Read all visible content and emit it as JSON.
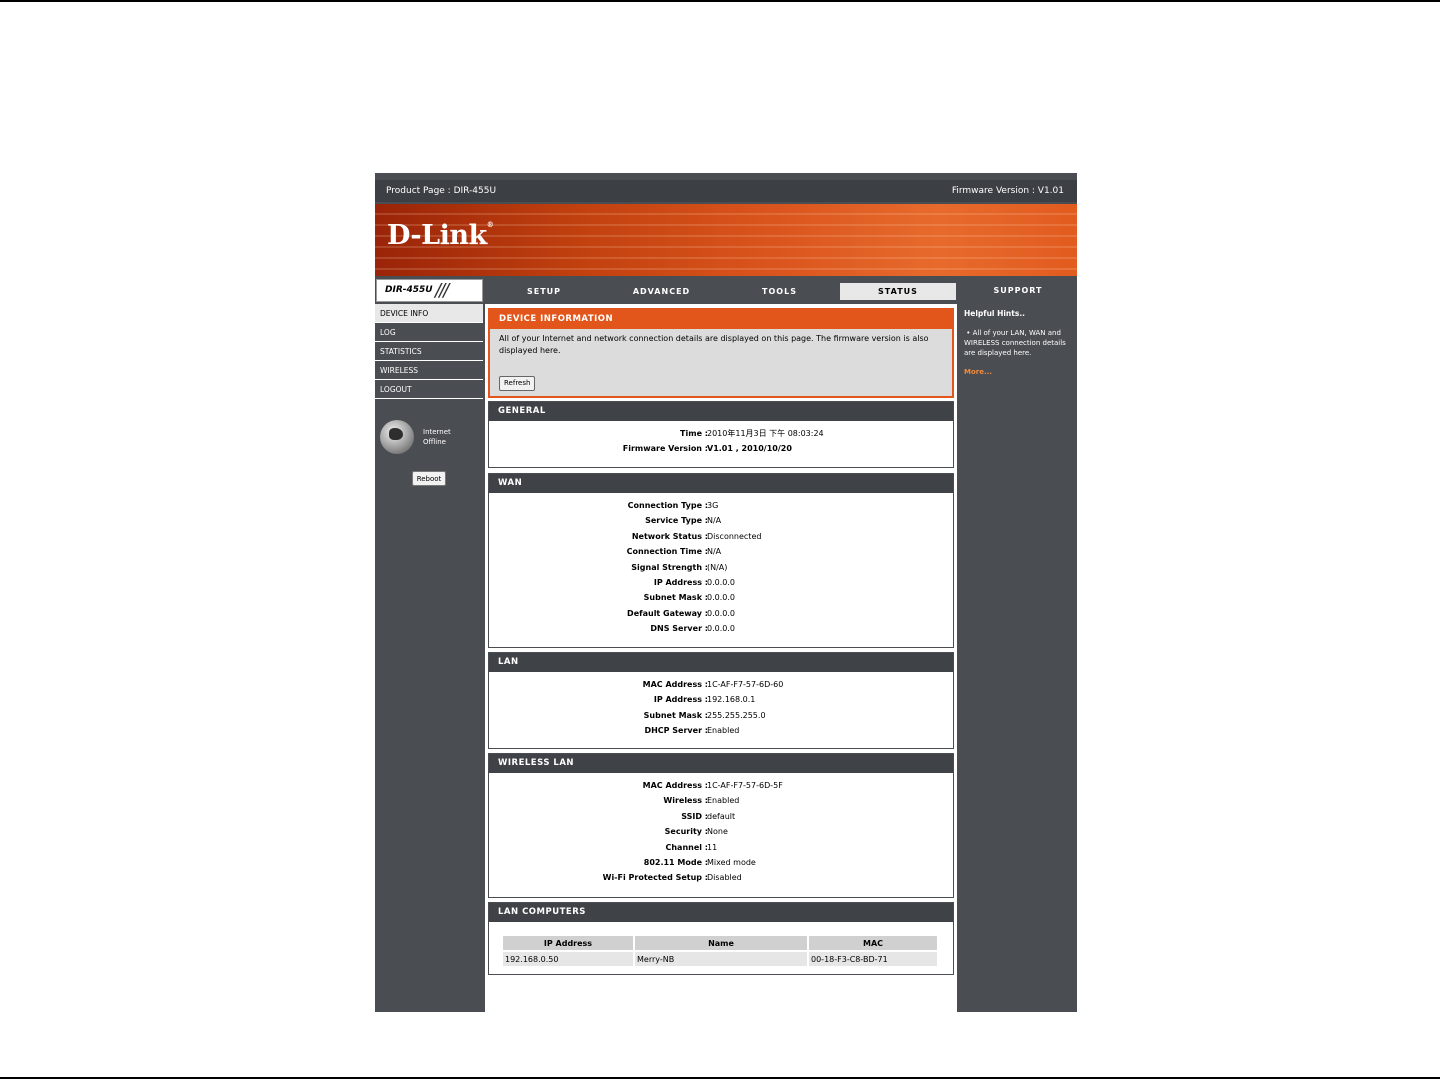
{
  "topbar": {
    "product_page": "Product Page :  DIR-455U",
    "firmware": "Firmware Version : V1.01"
  },
  "brand": {
    "logo": "D-Link",
    "accent": "#e2561b"
  },
  "model_tab": "DIR-455U",
  "tabs": [
    "SETUP",
    "ADVANCED",
    "TOOLS",
    "STATUS"
  ],
  "active_tab": "STATUS",
  "support_tab": "SUPPORT",
  "sidebar": {
    "items": [
      {
        "label": "DEVICE INFO",
        "active": true
      },
      {
        "label": "LOG"
      },
      {
        "label": "STATISTICS"
      },
      {
        "label": "WIRELESS"
      },
      {
        "label": "LOGOUT"
      }
    ],
    "status_line1": "Internet",
    "status_line2": "Offline",
    "reboot_label": "Reboot"
  },
  "device_info": {
    "title": "DEVICE INFORMATION",
    "text": "All of your Internet and network connection details are displayed on this page. The firmware version is also displayed here.",
    "refresh_label": "Refresh"
  },
  "general": {
    "title": "GENERAL",
    "rows": [
      {
        "label": "Time :",
        "value": "2010年11月3日 下午 08:03:24"
      },
      {
        "label": "Firmware Version :",
        "value": "V1.01 , 2010/10/20"
      }
    ]
  },
  "wan": {
    "title": "WAN",
    "rows": [
      {
        "label": "Connection Type :",
        "value": "3G"
      },
      {
        "label": "Service Type :",
        "value": "N/A"
      },
      {
        "label": "Network Status :",
        "value": "Disconnected"
      },
      {
        "label": "Connection Time :",
        "value": "N/A"
      },
      {
        "label": "Signal Strength :",
        "value": " (N/A)"
      },
      {
        "label": "IP Address :",
        "value": "0.0.0.0"
      },
      {
        "label": "Subnet Mask :",
        "value": "0.0.0.0"
      },
      {
        "label": "Default Gateway :",
        "value": "0.0.0.0"
      },
      {
        "label": "DNS Server :",
        "value": "0.0.0.0"
      }
    ]
  },
  "lan": {
    "title": "LAN",
    "rows": [
      {
        "label": "MAC Address :",
        "value": "1C-AF-F7-57-6D-60"
      },
      {
        "label": "IP Address :",
        "value": "192.168.0.1"
      },
      {
        "label": "Subnet Mask :",
        "value": "255.255.255.0"
      },
      {
        "label": "DHCP Server :",
        "value": "Enabled"
      }
    ]
  },
  "wireless_lan": {
    "title": "WIRELESS LAN",
    "rows": [
      {
        "label": "MAC Address :",
        "value": "1C-AF-F7-57-6D-5F"
      },
      {
        "label": "Wireless :",
        "value": "Enabled"
      },
      {
        "label": "SSID :",
        "value": "default"
      },
      {
        "label": "Security :",
        "value": "None"
      },
      {
        "label": "Channel :",
        "value": "11"
      },
      {
        "label": "802.11 Mode :",
        "value": "Mixed mode"
      },
      {
        "label": "Wi-Fi Protected Setup :",
        "value": "Disabled"
      }
    ]
  },
  "lan_computers": {
    "title": "LAN COMPUTERS",
    "columns": [
      "IP Address",
      "Name",
      "MAC"
    ],
    "rows": [
      [
        "192.168.0.50",
        "Merry-NB",
        "00-18-F3-C8-BD-71"
      ]
    ]
  },
  "hints": {
    "title": "Helpful Hints..",
    "body": "All of your LAN, WAN and WIRELESS connection details are displayed here.",
    "more": "More..."
  }
}
